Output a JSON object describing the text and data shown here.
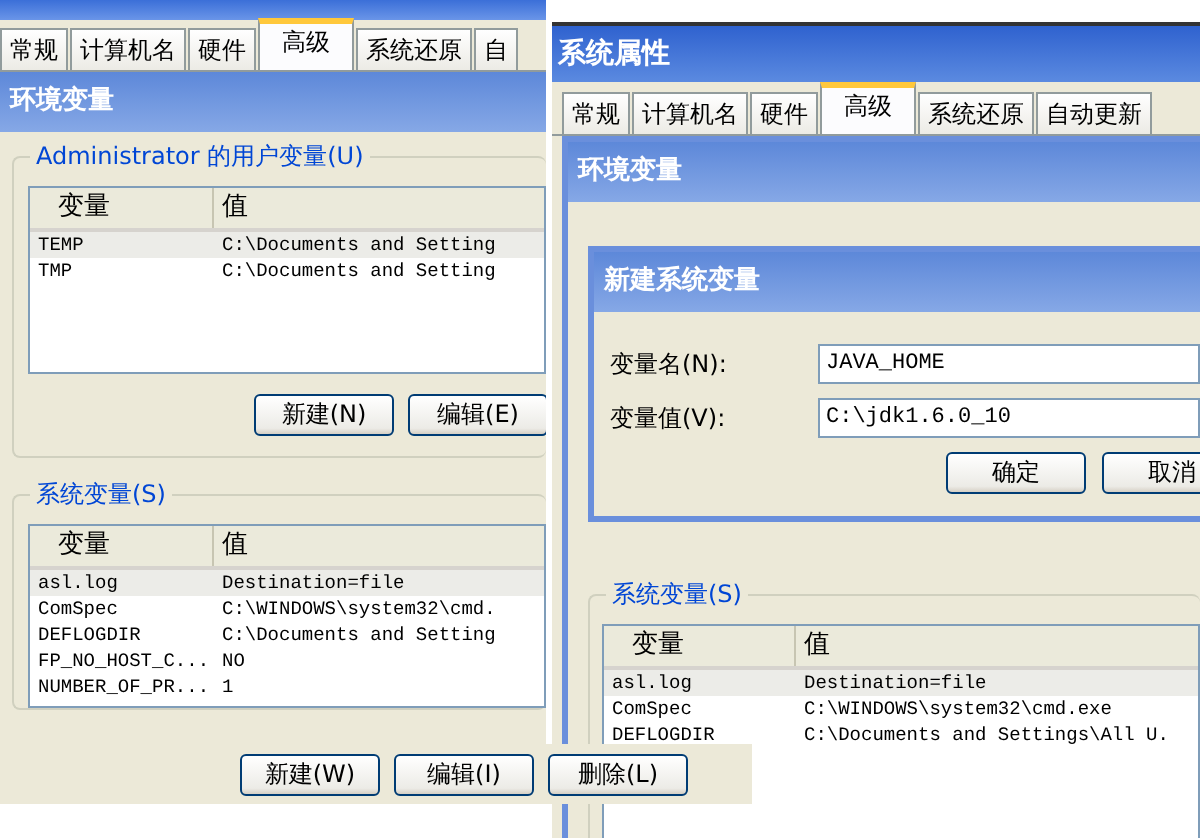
{
  "back_window": {
    "tabs": [
      {
        "label": "常规",
        "selected": false
      },
      {
        "label": "计算机名",
        "selected": false
      },
      {
        "label": "硬件",
        "selected": false
      },
      {
        "label": "高级",
        "selected": true
      },
      {
        "label": "系统还原",
        "selected": false
      },
      {
        "label": "自",
        "selected": false
      }
    ],
    "dialog_title": "环境变量",
    "user_group": {
      "title": "Administrator 的用户变量(U)",
      "columns": [
        "变量",
        "值"
      ],
      "rows": [
        {
          "name": "TEMP",
          "value": "C:\\Documents and Setting",
          "selected": true
        },
        {
          "name": "TMP",
          "value": "C:\\Documents and Setting",
          "selected": false
        }
      ],
      "buttons": [
        "新建(N)",
        "编辑(E)"
      ]
    },
    "system_group": {
      "title": "系统变量(S)",
      "columns": [
        "变量",
        "值"
      ],
      "rows": [
        {
          "name": "asl.log",
          "value": "Destination=file",
          "selected": true
        },
        {
          "name": "ComSpec",
          "value": "C:\\WINDOWS\\system32\\cmd.",
          "selected": false
        },
        {
          "name": "DEFLOGDIR",
          "value": "C:\\Documents and Setting",
          "selected": false
        },
        {
          "name": "FP_NO_HOST_C...",
          "value": "NO",
          "selected": false
        },
        {
          "name": "NUMBER_OF_PR...",
          "value": "1",
          "selected": false
        }
      ],
      "buttons": [
        "新建(W)",
        "编辑(I)",
        "删除(L)"
      ]
    }
  },
  "front_window": {
    "title": "系统属性",
    "tabs": [
      {
        "label": "常规",
        "selected": false
      },
      {
        "label": "计算机名",
        "selected": false
      },
      {
        "label": "硬件",
        "selected": false
      },
      {
        "label": "高级",
        "selected": true
      },
      {
        "label": "系统还原",
        "selected": false
      },
      {
        "label": "自动更新",
        "selected": false
      }
    ],
    "dialog_title": "环境变量",
    "new_variable_dialog": {
      "title": "新建系统变量",
      "fields": [
        {
          "label": "变量名(N):",
          "value": "JAVA_HOME"
        },
        {
          "label": "变量值(V):",
          "value": "C:\\jdk1.6.0_10"
        }
      ],
      "buttons": [
        "确定",
        "取消"
      ]
    },
    "system_group": {
      "title": "系统变量(S)",
      "columns": [
        "变量",
        "值"
      ],
      "rows": [
        {
          "name": "asl.log",
          "value": "Destination=file",
          "selected": true
        },
        {
          "name": "ComSpec",
          "value": "C:\\WINDOWS\\system32\\cmd.exe",
          "selected": false
        },
        {
          "name": "DEFLOGDIR",
          "value": "C:\\Documents and Settings\\All U.",
          "selected": false
        }
      ]
    }
  }
}
